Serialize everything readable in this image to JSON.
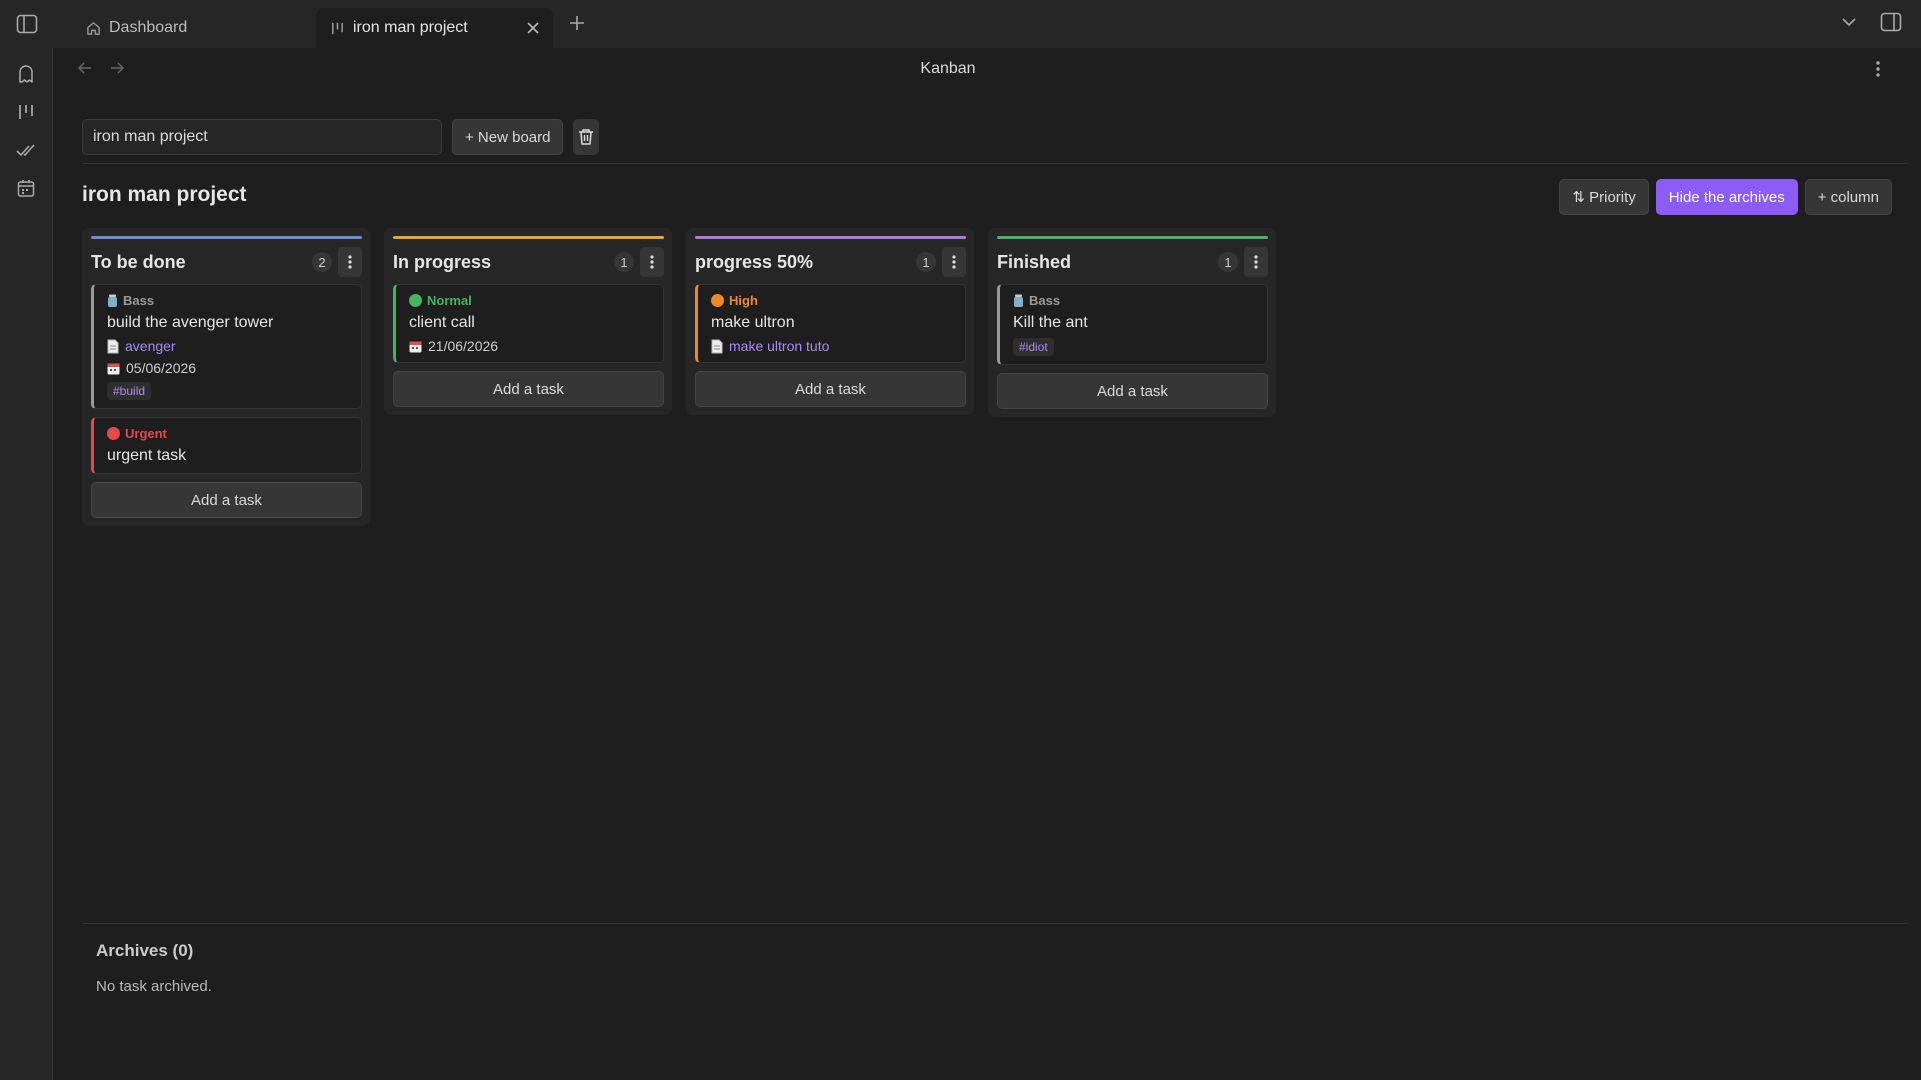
{
  "titlebar": {
    "tabs": [
      {
        "label": "Dashboard",
        "icon": "home-icon"
      },
      {
        "label": "iron man project",
        "icon": "kanban-icon",
        "active": true
      }
    ]
  },
  "ribbon": {
    "icons": [
      "ghost-icon",
      "kanban-icon",
      "double-check-icon",
      "calendar-icon"
    ]
  },
  "view": {
    "title": "Kanban"
  },
  "board_bar": {
    "board_name_value": "iron man project",
    "new_board_label": "+ New board"
  },
  "board": {
    "title": "iron man project",
    "priority_label": "⇅ Priority",
    "hide_archives_label": "Hide the archives",
    "add_column_label": "+ column"
  },
  "columns": [
    {
      "title": "To be done",
      "count": "2",
      "bar_color": "#6b8fd6",
      "add_label": "Add a task",
      "cards": [
        {
          "priority": "Bass",
          "priority_icon": "jar-icon",
          "priority_color": "#9a9a9a",
          "border_color": "#9a9a9a",
          "title": "build the avenger tower",
          "link": "avenger",
          "date": "05/06/2026",
          "tag": "#build"
        },
        {
          "priority": "Urgent",
          "priority_icon": "red-circle-icon",
          "priority_color": "#e5484d",
          "border_color": "#e5484d",
          "title": "urgent task"
        }
      ]
    },
    {
      "title": "In progress",
      "count": "1",
      "bar_color": "#e5a82e",
      "add_label": "Add a task",
      "cards": [
        {
          "priority": "Normal",
          "priority_icon": "green-circle-icon",
          "priority_color": "#46b35f",
          "border_color": "#46b35f",
          "title": "client call",
          "date": "21/06/2026"
        }
      ]
    },
    {
      "title": "progress 50%",
      "count": "1",
      "bar_color": "#b07be0",
      "add_label": "Add a task",
      "cards": [
        {
          "priority": "High",
          "priority_icon": "orange-circle-icon",
          "priority_color": "#f08a24",
          "border_color": "#f08a24",
          "title": "make ultron",
          "link": "make ultron tuto"
        }
      ]
    },
    {
      "title": "Finished",
      "count": "1",
      "bar_color": "#4caf6a",
      "add_label": "Add a task",
      "cards": [
        {
          "priority": "Bass",
          "priority_icon": "jar-icon",
          "priority_color": "#9a9a9a",
          "border_color": "#9a9a9a",
          "title": "Kill the ant",
          "tag": "#idiot"
        }
      ]
    }
  ],
  "archives": {
    "title": "Archives (0)",
    "empty_text": "No task archived."
  }
}
